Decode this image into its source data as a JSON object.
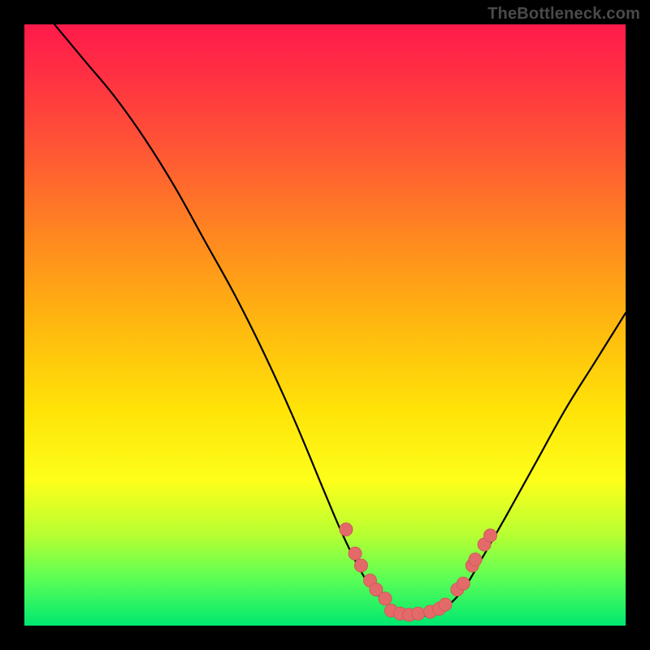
{
  "watermark": "TheBottleneck.com",
  "colors": {
    "curve_stroke": "#000000",
    "marker_fill": "#e46a6a",
    "marker_stroke": "#cf5a5a"
  },
  "chart_data": {
    "type": "line",
    "title": "",
    "xlabel": "",
    "ylabel": "",
    "xlim": [
      0,
      100
    ],
    "ylim": [
      0,
      100
    ],
    "series": [
      {
        "name": "curve",
        "x": [
          5,
          10,
          15,
          20,
          25,
          30,
          35,
          40,
          45,
          50,
          53,
          56,
          58,
          60,
          63,
          65,
          68,
          70,
          73,
          76,
          80,
          85,
          90,
          95,
          100
        ],
        "y": [
          100,
          94,
          88,
          81,
          73,
          64,
          55,
          45,
          34,
          22,
          15,
          9,
          6,
          4,
          2,
          1.5,
          2,
          3,
          6,
          11,
          18,
          27,
          36,
          44,
          52
        ]
      }
    ],
    "markers": [
      {
        "x": 53.5,
        "y": 16
      },
      {
        "x": 55.0,
        "y": 12
      },
      {
        "x": 56.0,
        "y": 10
      },
      {
        "x": 57.5,
        "y": 7.5
      },
      {
        "x": 58.5,
        "y": 6.0
      },
      {
        "x": 60.0,
        "y": 4.5
      },
      {
        "x": 61.0,
        "y": 2.5
      },
      {
        "x": 62.5,
        "y": 2.0
      },
      {
        "x": 64.0,
        "y": 1.8
      },
      {
        "x": 65.5,
        "y": 2.0
      },
      {
        "x": 67.5,
        "y": 2.3
      },
      {
        "x": 69.0,
        "y": 2.8
      },
      {
        "x": 70.0,
        "y": 3.5
      },
      {
        "x": 72.0,
        "y": 6.0
      },
      {
        "x": 73.0,
        "y": 7.0
      },
      {
        "x": 74.5,
        "y": 10.0
      },
      {
        "x": 75.0,
        "y": 11.0
      },
      {
        "x": 76.5,
        "y": 13.5
      },
      {
        "x": 77.5,
        "y": 15.0
      }
    ]
  }
}
